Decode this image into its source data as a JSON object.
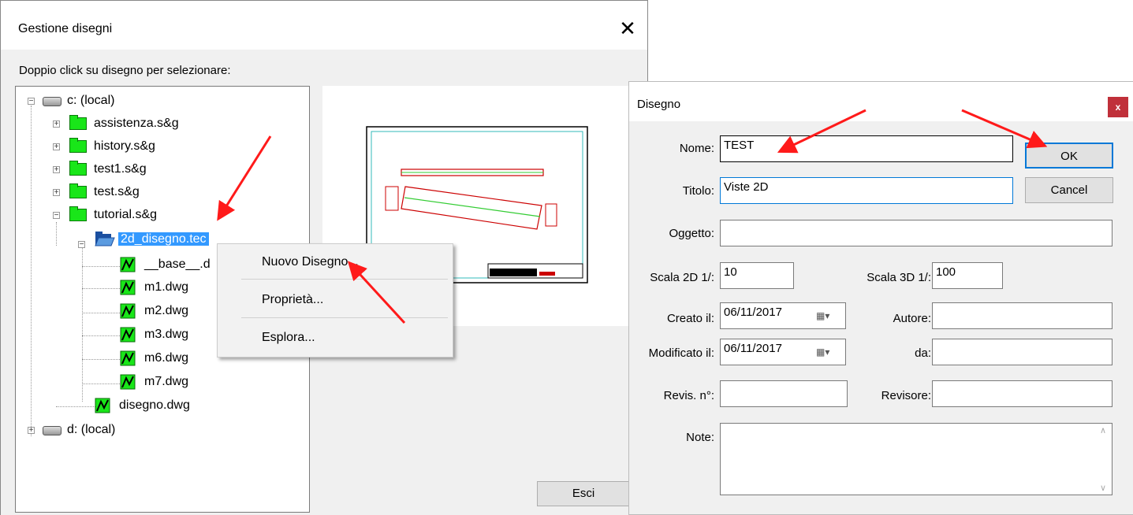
{
  "gestione": {
    "title": "Gestione disegni",
    "close": "✕",
    "instruction": "Doppio click su disegno per selezionare:",
    "exit_button": "Esci",
    "tree": {
      "c_drive": "c: (local)",
      "folders": [
        "assistenza.s&g",
        "history.s&g",
        "test1.s&g",
        "test.s&g",
        "tutorial.s&g"
      ],
      "selected_folder": "2d_disegno.tec",
      "files": [
        "__base__.d",
        "m1.dwg",
        "m2.dwg",
        "m3.dwg",
        "m6.dwg",
        "m7.dwg"
      ],
      "loose_file": "disegno.dwg",
      "d_drive": "d: (local)"
    }
  },
  "context_menu": {
    "items": [
      "Nuovo Disegno...",
      "Proprietà...",
      "Esplora..."
    ]
  },
  "disegno": {
    "title": "Disegno",
    "close": "x",
    "labels": {
      "nome": "Nome:",
      "titolo": "Titolo:",
      "oggetto": "Oggetto:",
      "scala2d": "Scala 2D 1/:",
      "scala3d": "Scala 3D 1/:",
      "creato": "Creato il:",
      "autore": "Autore:",
      "modificato": "Modificato il:",
      "da": "da:",
      "revis": "Revis. n°:",
      "revisore": "Revisore:",
      "note": "Note:"
    },
    "values": {
      "nome": "TEST",
      "titolo": "Viste 2D",
      "oggetto": "",
      "scala2d": "10",
      "scala3d": "100",
      "creato": "06/11/2017",
      "modificato": "06/11/2017",
      "autore": "",
      "da": "",
      "revis": "",
      "revisore": "",
      "note": ""
    },
    "ok_button": "OK",
    "cancel_button": "Cancel"
  },
  "colors": {
    "selection": "#3399ff",
    "folder": "#19e619",
    "arrow": "#ff1a1a",
    "ok_border": "#0078d7"
  }
}
